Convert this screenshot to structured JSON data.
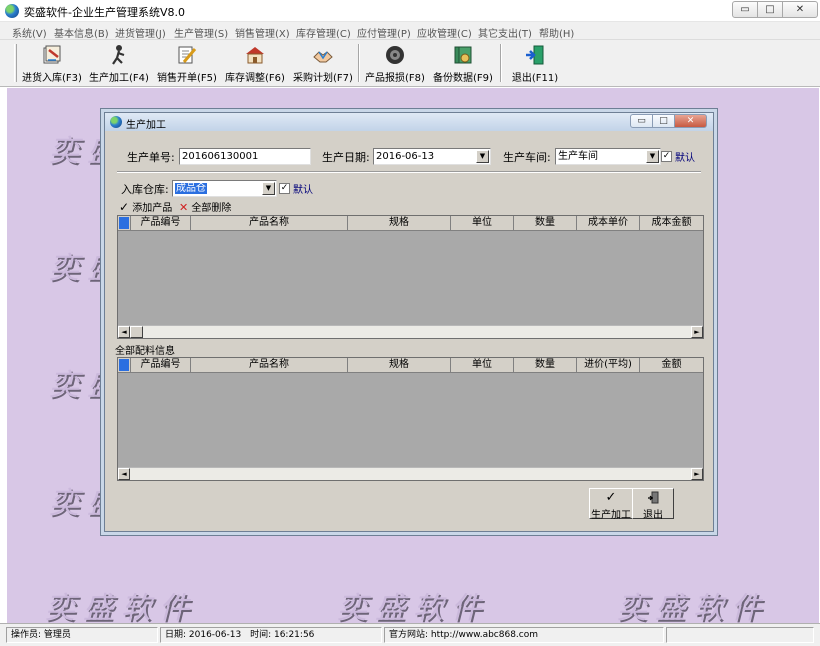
{
  "window": {
    "title": "奕盛软件-企业生产管理系统V8.0",
    "min_glyph": "▭",
    "max_glyph": "□",
    "close_glyph": "✕"
  },
  "menu": [
    "系统(V)",
    "基本信息(B)",
    "进货管理(J)",
    "生产管理(S)",
    "销售管理(X)",
    "库存管理(C)",
    "应付管理(P)",
    "应收管理(C)",
    "其它支出(T)",
    "帮助(H)"
  ],
  "toolbar": [
    {
      "label": "进货入库(F3)",
      "icon": "stock-in-icon"
    },
    {
      "label": "生产加工(F4)",
      "icon": "production-icon"
    },
    {
      "label": "销售开单(F5)",
      "icon": "sales-order-icon"
    },
    {
      "label": "库存调整(F6)",
      "icon": "warehouse-adjust-icon"
    },
    {
      "label": "采购计划(F7)",
      "icon": "purchase-plan-icon"
    },
    {
      "label": "产品报损(F8)",
      "icon": "product-loss-icon"
    },
    {
      "label": "备份数据(F9)",
      "icon": "backup-icon"
    },
    {
      "label": "退出(F11)",
      "icon": "exit-icon"
    }
  ],
  "watermark": "奕盛软件",
  "dialog": {
    "title": "生产加工",
    "order_no_label": "生产单号:",
    "order_no_value": "201606130001",
    "date_label": "生产日期:",
    "date_value": "2016-06-13",
    "workshop_label": "生产车间:",
    "workshop_value": "生产车间",
    "default_label": "默认",
    "warehouse_label": "入库仓库:",
    "warehouse_value": "成品仓",
    "add_product": "添加产品",
    "delete_all": "全部删除",
    "check_glyph": "✓",
    "products_columns": [
      "产品编号",
      "产品名称",
      "规格",
      "单位",
      "数量",
      "成本单价",
      "成本金额"
    ],
    "materials_title": "全部配料信息",
    "materials_columns": [
      "产品编号",
      "产品名称",
      "规格",
      "单位",
      "数量",
      "进价(平均)",
      "金额"
    ],
    "produce_button": "生产加工",
    "exit_button": "退出",
    "scroll_left": "◄",
    "scroll_right": "►",
    "dropdown_glyph": "▼"
  },
  "status": {
    "operator": "操作员: 管理员",
    "date": "日期: 2016-06-13",
    "time": "时间: 16:21:56",
    "website": "官方网站: http://www.abc868.com"
  },
  "colors": {
    "desktop": "#d8c7e6",
    "selection": "#2b6fe0",
    "grid_body": "#a9a9a9"
  }
}
